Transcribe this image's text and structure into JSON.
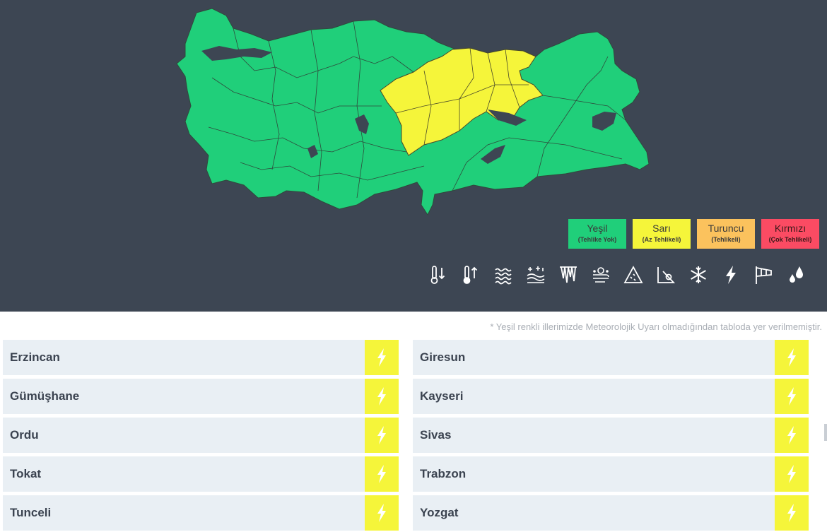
{
  "colors": {
    "background": "#3d4653",
    "green": "#20cf7a",
    "yellow": "#f5f53a",
    "orange": "#fbc25d",
    "red": "#fb4b63",
    "row": "#e9eff4"
  },
  "map": {
    "name": "turkey-warning-map",
    "yellow_regions": [
      "Erzincan",
      "Giresun",
      "Gümüşhane",
      "Kayseri",
      "Ordu",
      "Sivas",
      "Tokat",
      "Trabzon",
      "Tunceli",
      "Yozgat"
    ]
  },
  "legend": [
    {
      "title": "Yeşil",
      "subtitle": "(Tehlike Yok)"
    },
    {
      "title": "Sarı",
      "subtitle": "(Az Tehlikeli)"
    },
    {
      "title": "Turuncu",
      "subtitle": "(Tehlikeli)"
    },
    {
      "title": "Kırmızı",
      "subtitle": "(Çok Tehlikeli)"
    }
  ],
  "hazard_icons": [
    "cold-icon",
    "heat-icon",
    "fog-icon",
    "snow-melt-icon",
    "ice-icon",
    "dust-icon",
    "avalanche-icon",
    "landslide-icon",
    "snow-icon",
    "lightning-icon",
    "wind-icon",
    "rain-icon"
  ],
  "note": "* Yeşil renkli illerimizde Meteorolojik Uyarı olmadığından tabloda yer verilmemiştir.",
  "provinces_left": [
    {
      "name": "Erzincan",
      "icon": "lightning-icon"
    },
    {
      "name": "Gümüşhane",
      "icon": "lightning-icon"
    },
    {
      "name": "Ordu",
      "icon": "lightning-icon"
    },
    {
      "name": "Tokat",
      "icon": "lightning-icon"
    },
    {
      "name": "Tunceli",
      "icon": "lightning-icon"
    }
  ],
  "provinces_right": [
    {
      "name": "Giresun",
      "icon": "lightning-icon"
    },
    {
      "name": "Kayseri",
      "icon": "lightning-icon"
    },
    {
      "name": "Sivas",
      "icon": "lightning-icon"
    },
    {
      "name": "Trabzon",
      "icon": "lightning-icon"
    },
    {
      "name": "Yozgat",
      "icon": "lightning-icon"
    }
  ]
}
